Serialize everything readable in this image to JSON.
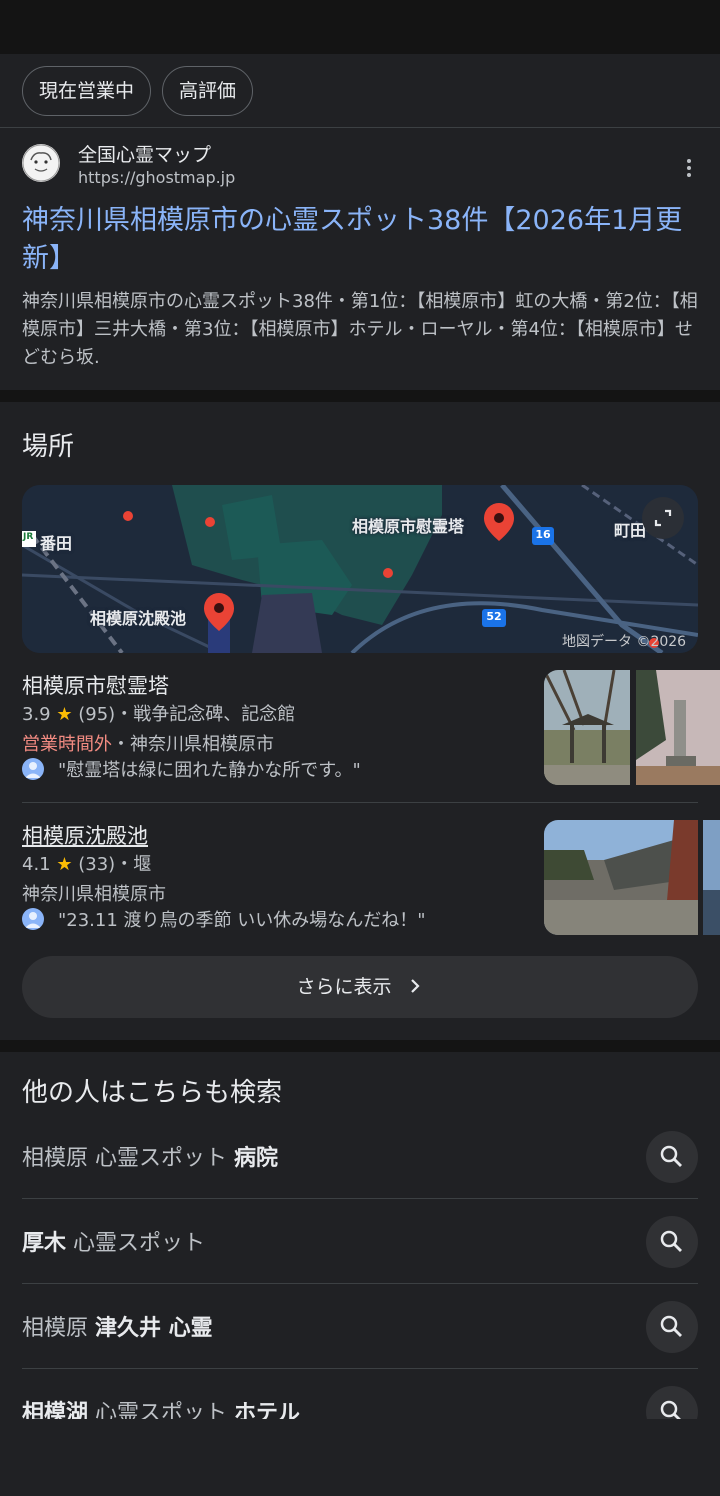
{
  "filters": [
    "現在営業中",
    "高評価"
  ],
  "result": {
    "site_name": "全国心霊マップ",
    "site_url": "https://ghostmap.jp",
    "title": "神奈川県相模原市の心霊スポット38件【2026年1月更新】",
    "snippet": "神奈川県相模原市の心霊スポット38件・第1位：【相模原市】虹の大橋・第2位：【相模原市】三井大橋・第3位：【相模原市】ホテル・ローヤル・第4位：【相模原市】せどむら坂."
  },
  "places": {
    "title": "場所",
    "map": {
      "labels": [
        "相模原市慰霊塔",
        "相模原沈殿池",
        "番田",
        "町田"
      ],
      "route_numbers": [
        "16",
        "52"
      ],
      "jr_badge": "JR",
      "credit": "地図データ ©2026"
    },
    "items": [
      {
        "name": "相模原市慰霊塔",
        "rating": "3.9",
        "star": "★",
        "count": "(95)",
        "category": "戦争記念碑、記念館",
        "status": "営業時間外",
        "address_sep": "・",
        "address": "神奈川県相模原市",
        "review": "\"慰霊塔は緑に囲れた静かな所です。\""
      },
      {
        "name": "相模原沈殿池",
        "rating": "4.1",
        "star": "★",
        "count": "(33)",
        "category": "堰",
        "address": "神奈川県相模原市",
        "review": "\"23.11 渡り鳥の季節 いい休み場なんだね！\""
      }
    ],
    "more": "さらに表示"
  },
  "related": {
    "title": "他の人はこちらも検索",
    "items": [
      {
        "parts": [
          {
            "t": "相模原 心霊スポット ",
            "b": false
          },
          {
            "t": "病院",
            "b": true
          }
        ]
      },
      {
        "parts": [
          {
            "t": "厚木",
            "b": true
          },
          {
            "t": " 心霊スポット",
            "b": false
          }
        ]
      },
      {
        "parts": [
          {
            "t": "相模原 ",
            "b": false
          },
          {
            "t": "津久井 心霊",
            "b": true
          }
        ]
      },
      {
        "parts": [
          {
            "t": "相模湖",
            "b": true
          },
          {
            "t": " 心霊スポット ",
            "b": false
          },
          {
            "t": "ホテル",
            "b": true
          }
        ]
      }
    ]
  },
  "colors": {
    "link": "#8ab4f8",
    "closed": "#f28b82",
    "star": "#fbbc04",
    "pin": "#ea4335"
  },
  "icons": [
    "kebab-menu-icon",
    "expand-icon",
    "star-icon",
    "avatar-icon",
    "chevron-right-icon",
    "search-icon",
    "map-pin-icon"
  ]
}
